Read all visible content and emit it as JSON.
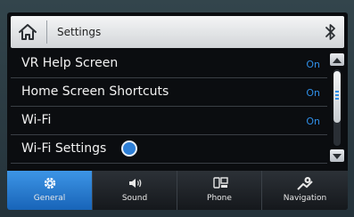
{
  "header": {
    "title": "Settings",
    "home_icon": "home-icon",
    "status_icon": "bluetooth-icon"
  },
  "list": {
    "items": [
      {
        "label": "VR Help Screen",
        "value": "On"
      },
      {
        "label": "Home Screen Shortcuts",
        "value": "On"
      },
      {
        "label": "Wi-Fi",
        "value": "On"
      },
      {
        "label": "Wi-Fi Settings",
        "value": ""
      }
    ]
  },
  "nav": {
    "tabs": [
      {
        "label": "General",
        "icon": "gear-icon",
        "active": true
      },
      {
        "label": "Sound",
        "icon": "speaker-icon",
        "active": false
      },
      {
        "label": "Phone",
        "icon": "phone-icon",
        "active": false
      },
      {
        "label": "Navigation",
        "icon": "navigation-icon",
        "active": false
      }
    ]
  },
  "colors": {
    "accent": "#2f8ee6",
    "active_tab": "#2a7fd4",
    "background": "#0b0d10"
  }
}
